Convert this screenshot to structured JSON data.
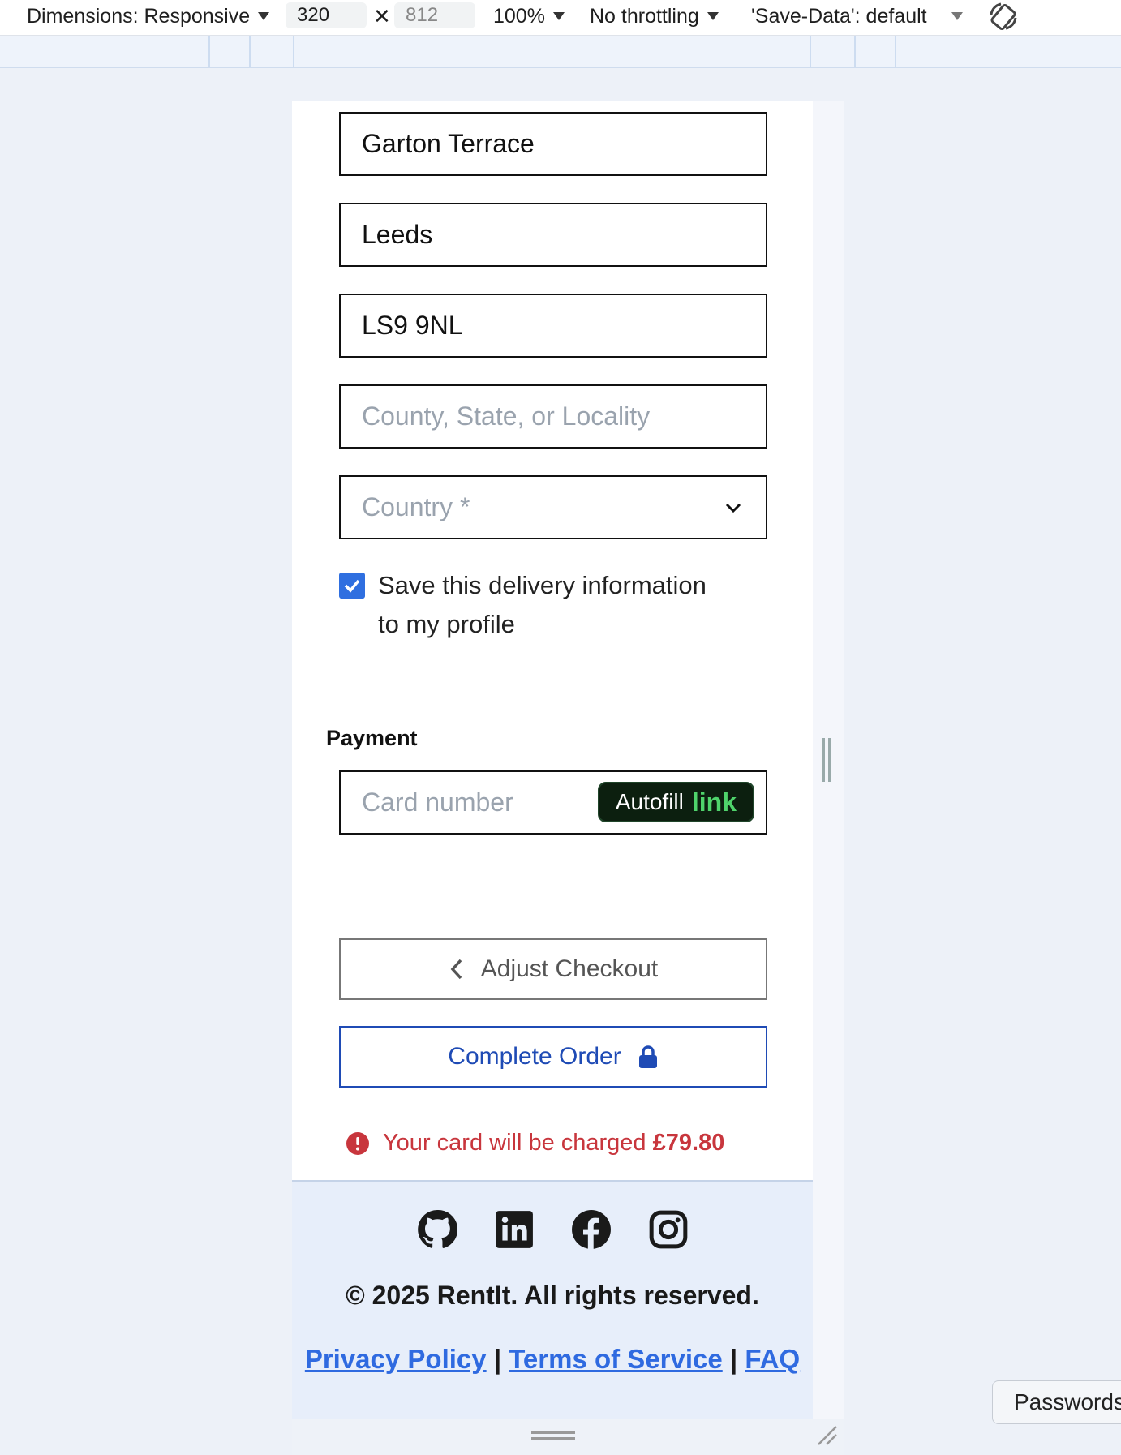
{
  "devtools": {
    "dimensions_label": "Dimensions: Responsive",
    "width_value": "320",
    "height_placeholder": "812",
    "zoom": "100%",
    "throttling": "No throttling",
    "save_data": "'Save-Data': default"
  },
  "form": {
    "street": "Garton Terrace",
    "city": "Leeds",
    "postcode": "LS9 9NL",
    "county_placeholder": "County, State, or Locality",
    "country_placeholder": "Country *",
    "save_checkbox_checked": true,
    "save_checkbox_label": "Save this delivery information to my profile"
  },
  "payment": {
    "section_label": "Payment",
    "card_placeholder": "Card number",
    "autofill_label": "Autofill",
    "autofill_brand": "link"
  },
  "actions": {
    "back_label": "Adjust Checkout",
    "complete_label": "Complete Order"
  },
  "charge": {
    "prefix": "Your card will be charged ",
    "amount": "£79.80"
  },
  "footer": {
    "social_icons": [
      "github-icon",
      "linkedin-icon",
      "facebook-icon",
      "instagram-icon"
    ],
    "copyright": "© 2025 RentIt. All rights reserved.",
    "links": [
      "Privacy Policy",
      "Terms of Service",
      "FAQ"
    ],
    "separator": "|"
  },
  "browser": {
    "passwords_tooltip": "Passwords"
  },
  "colors": {
    "accent_blue": "#2f6fe0",
    "complete_blue": "#1f4bb5",
    "error_red": "#c8363d",
    "link_green": "#4fd36b",
    "footer_bg": "#e7eefa"
  }
}
